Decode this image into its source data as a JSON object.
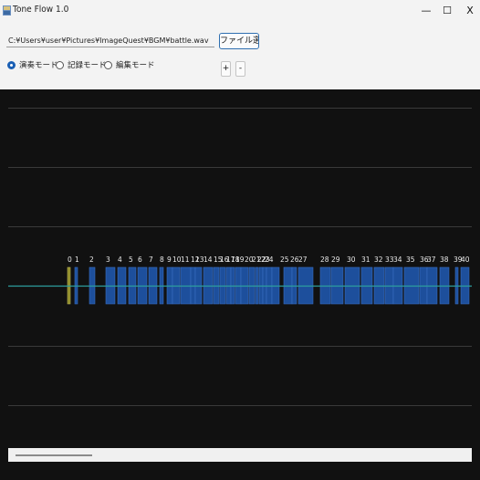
{
  "window": {
    "title": "Tone Flow 1.0",
    "controls": {
      "minimize": "—",
      "maximize": "☐",
      "close": "X"
    }
  },
  "toolbar": {
    "path_value": "C:¥Users¥user¥Pictures¥ImageQuest¥BGM¥battle.wav",
    "file_button_label": "ファイル選択",
    "modes": [
      {
        "label": "演奏モード",
        "selected": true
      },
      {
        "label": "記録モード",
        "selected": false
      },
      {
        "label": "編集モード",
        "selected": false
      }
    ],
    "zoom_in_label": "+",
    "zoom_out_label": "-"
  },
  "timeline": {
    "marker_numbers": [
      "0",
      "1",
      "2",
      "3",
      "4",
      "5",
      "6",
      "7",
      "8",
      "9",
      "10",
      "11",
      "12",
      "13",
      "14",
      "15",
      "16",
      "17",
      "18",
      "19",
      "20",
      "21",
      "22",
      "23",
      "24",
      "25",
      "26",
      "27",
      "28",
      "29",
      "30",
      "31",
      "32",
      "33",
      "34",
      "35",
      "36",
      "37",
      "38",
      "39",
      "40"
    ],
    "colors": {
      "background": "#111111",
      "note": "#1d4f9c",
      "first_note": "#8f8c2a",
      "playhead_line": "#2d9d9d",
      "grid": "#3a3a3a"
    }
  }
}
